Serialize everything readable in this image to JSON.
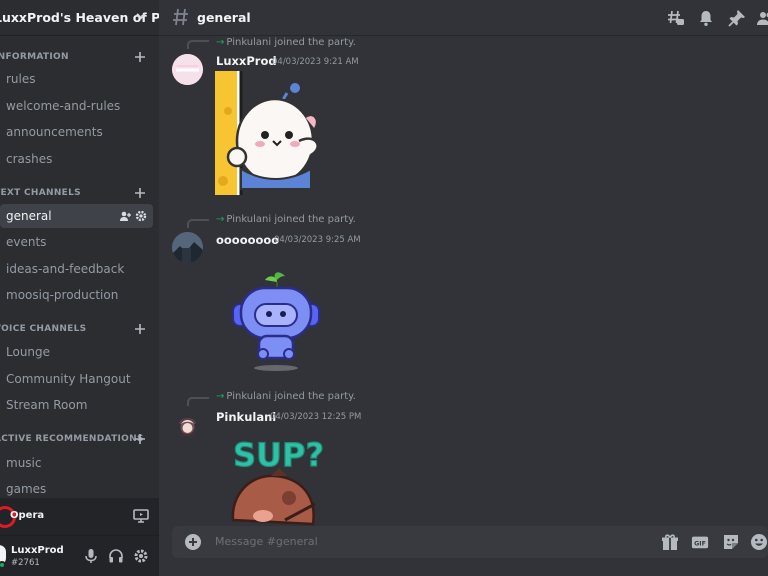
{
  "server": {
    "name": "LuxxProd's Heaven of Pe..."
  },
  "categories": [
    {
      "label": "INFORMATION",
      "channels": [
        "rules",
        "welcome-and-rules",
        "announcements",
        "crashes"
      ]
    },
    {
      "label": "TEXT CHANNELS",
      "channels": [
        "general",
        "events",
        "ideas-and-feedback",
        "moosiq-production"
      ]
    },
    {
      "label": "VOICE CHANNELS",
      "channels": [
        "Lounge",
        "Community Hangout",
        "Stream Room"
      ]
    },
    {
      "label": "ACTIVE RECOMMENDATIONS",
      "channels": [
        "music",
        "games"
      ]
    }
  ],
  "opera": {
    "label": "Opera"
  },
  "user": {
    "name": "LuxxProd",
    "tag": "#2761"
  },
  "topbar": {
    "channel": "general"
  },
  "messages": [
    {
      "system": "Pinkulani joined the party.",
      "author": "LuxxProd",
      "timestamp": "04/03/2023 9:21 AM"
    },
    {
      "system": "Pinkulani joined the party.",
      "author": "oooooooo",
      "timestamp": "04/03/2023 9:25 AM"
    },
    {
      "system": "Pinkulani joined the party.",
      "author": "Pinkulani",
      "timestamp": "04/03/2023 12:25 PM",
      "sticker_text": "SUP?"
    }
  ],
  "composer": {
    "placeholder": "Message #general",
    "gif_label": "GIF"
  },
  "colors": {
    "accent": "#5865f2",
    "online": "#23a55a",
    "join_arrow": "#23a55a"
  }
}
